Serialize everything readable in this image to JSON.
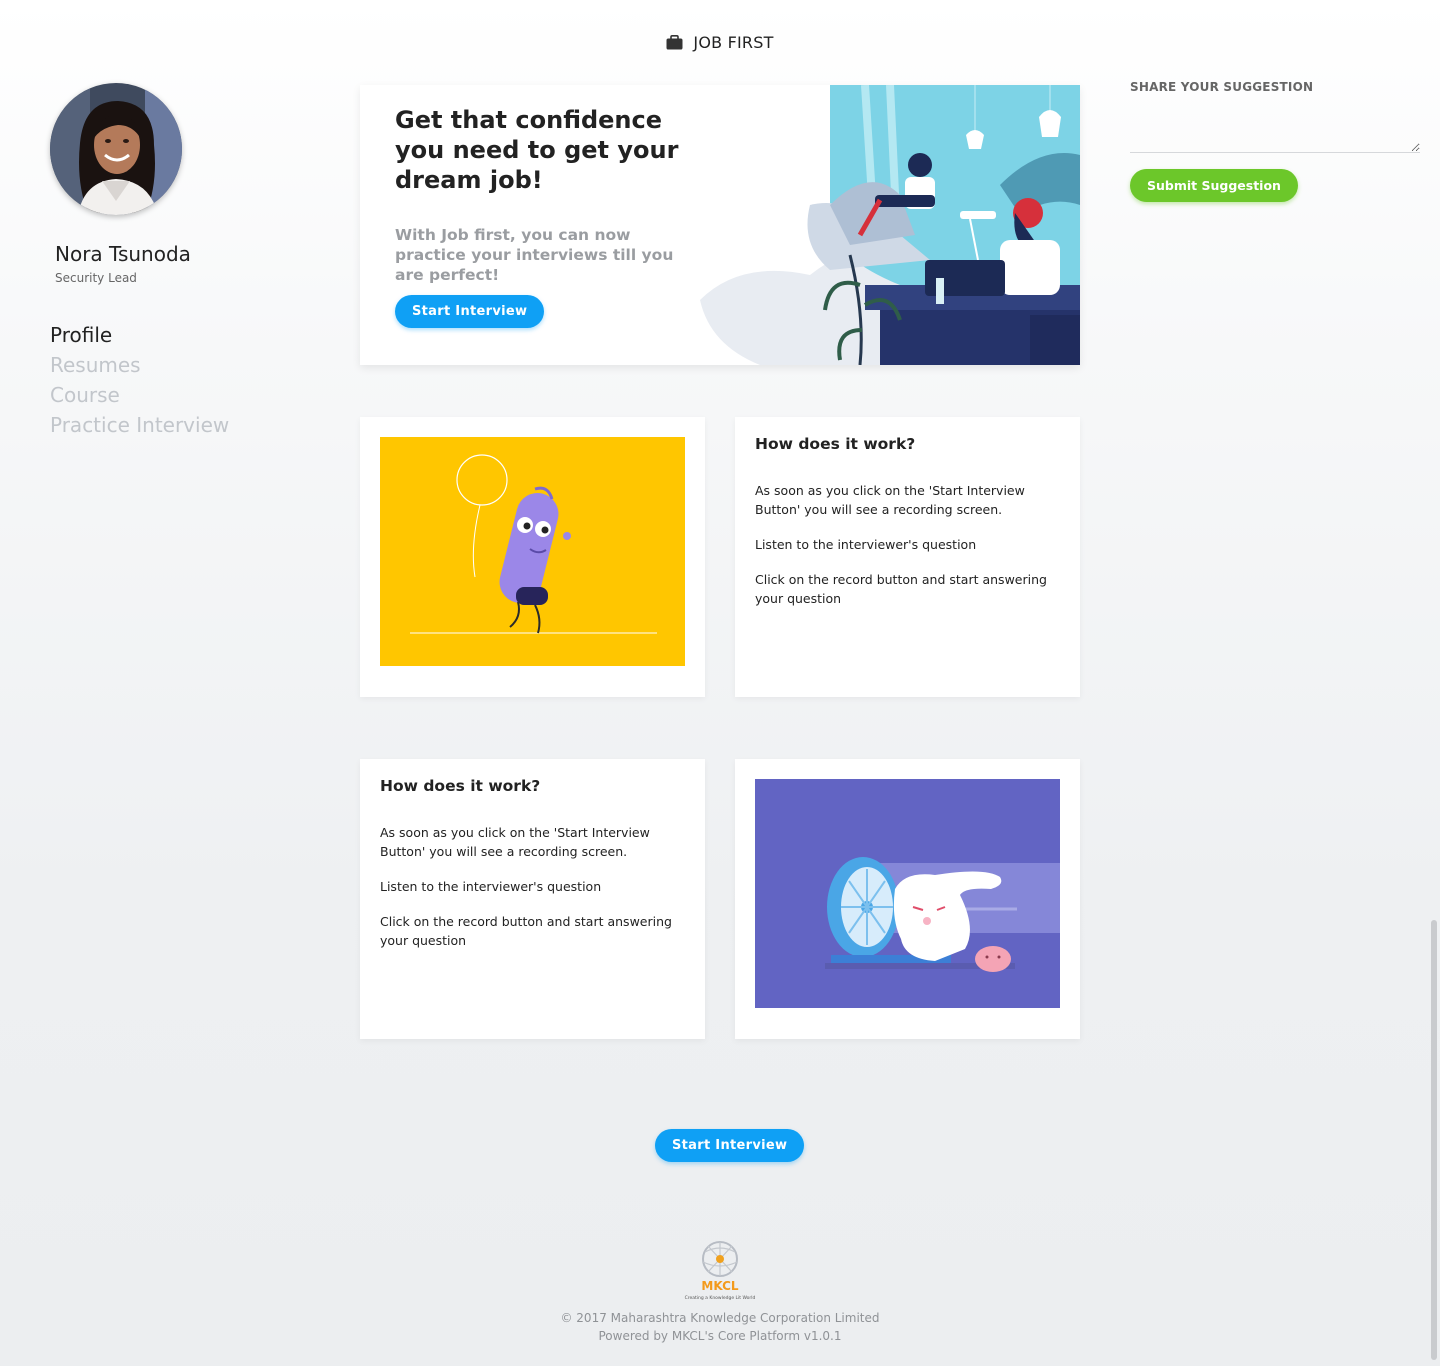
{
  "header": {
    "brand": "JOB FIRST",
    "brand_icon": "briefcase-icon"
  },
  "sidebar": {
    "user_name": "Nora Tsunoda",
    "user_role": "Security Lead",
    "nav": [
      {
        "label": "Profile",
        "active": true
      },
      {
        "label": "Resumes",
        "active": false
      },
      {
        "label": "Course",
        "active": false
      },
      {
        "label": "Practice Interview",
        "active": false
      }
    ]
  },
  "hero": {
    "title": "Get that confidence you need to get your dream job!",
    "subtitle": "With Job first, you can now practice your interviews till you are perfect!",
    "button": "Start Interview"
  },
  "suggestion": {
    "label": "SHARE YOUR SUGGESTION",
    "value": "",
    "button": "Submit Suggestion"
  },
  "how_it_works": [
    {
      "title": "How does it work?",
      "steps": [
        "As soon as you click on the 'Start Interview Button' you will see a recording screen.",
        "Listen to the interviewer's question",
        "Click on the record button and start answering your question"
      ]
    },
    {
      "title": "How does it work?",
      "steps": [
        "As soon as you click on the 'Start Interview Button' you will see a recording screen.",
        "Listen to the interviewer's question",
        "Click on the record button and start answering your question"
      ]
    }
  ],
  "bottom_button": "Start Interview",
  "footer": {
    "logo_text": "MKCL",
    "logo_tagline": "Creating a Knowledge Lit World",
    "copyright": "© 2017 Maharashtra Knowledge Corporation Limited",
    "powered": "Powered by MKCL's Core Platform v1.0.1"
  },
  "colors": {
    "primary": "#0fa0f5",
    "success": "#6cc72a",
    "card_yellow": "#ffc600",
    "card_purple": "#6264c3"
  }
}
